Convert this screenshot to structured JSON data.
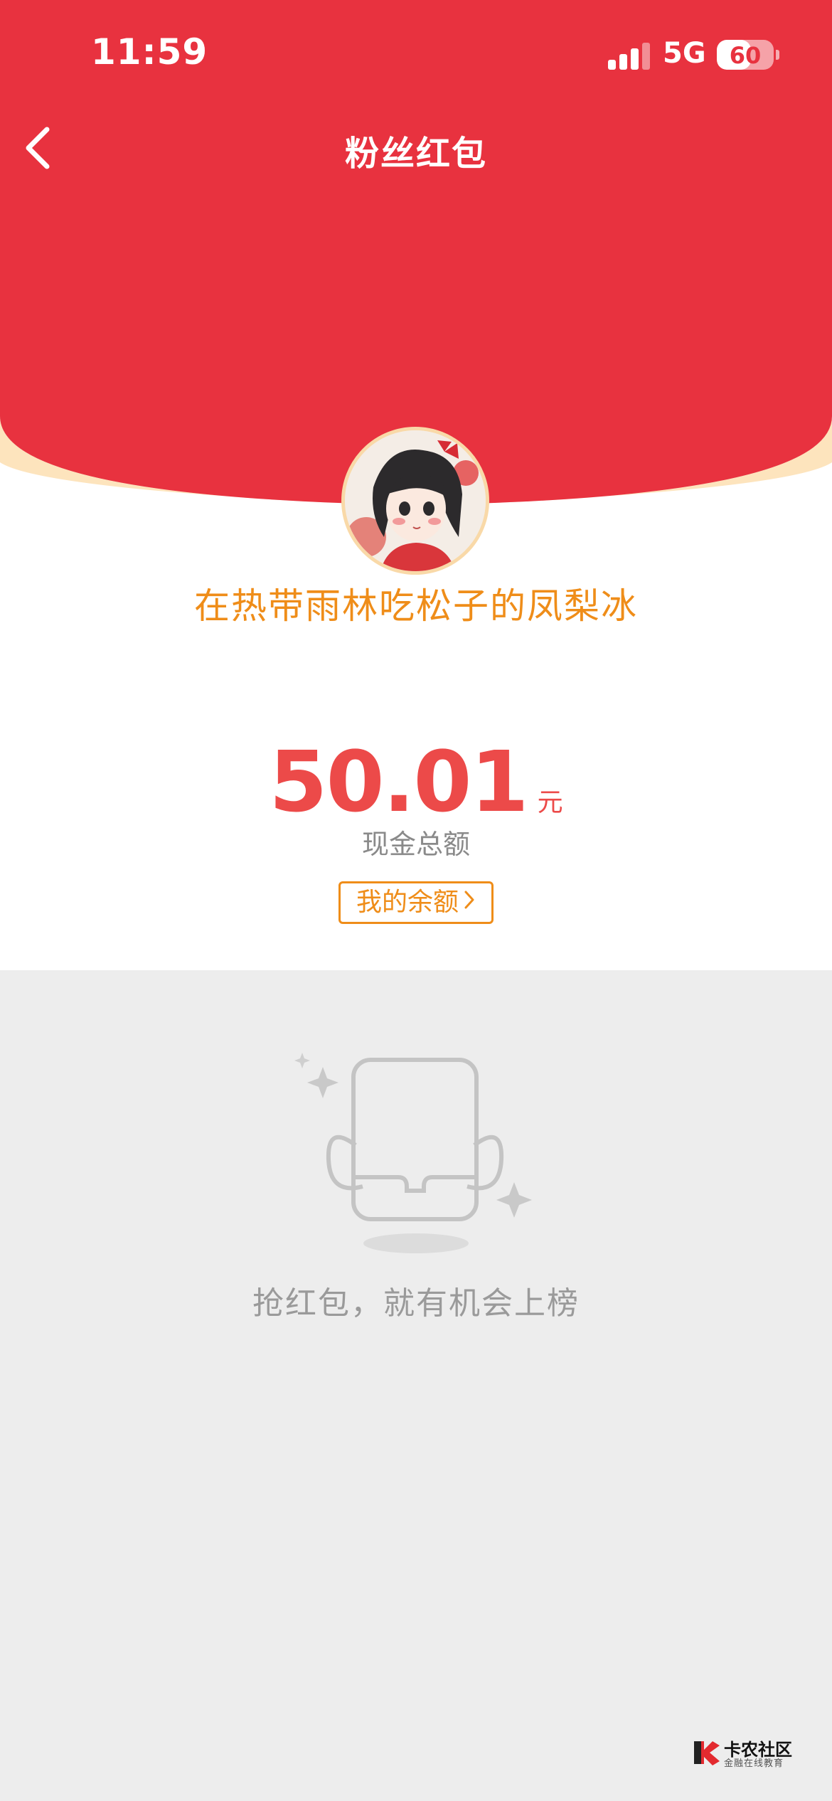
{
  "status_bar": {
    "time": "11:59",
    "network": "5G",
    "battery_level": "60",
    "battery_fraction": 0.6,
    "signal_bars": 3
  },
  "nav": {
    "title": "粉丝红包",
    "back_icon": "chevron-left-icon"
  },
  "envelope": {
    "sender_name": "在热带雨林吃松子的凤梨冰",
    "amount": "50.01",
    "unit": "元",
    "amount_label": "现金总额",
    "balance_button_label": "我的余额",
    "balance_button_icon": "chevron-right-icon"
  },
  "empty_state": {
    "icon": "red-packet-empty-icon",
    "message": "抢红包，就有机会上榜"
  },
  "watermark": {
    "brand": "卡农社区",
    "tagline": "金融在线教育"
  },
  "colors": {
    "header_red": "#e8323f",
    "accent_orange": "#ef8d19",
    "amount_red": "#ec4a49",
    "page_gray": "#ededed"
  }
}
